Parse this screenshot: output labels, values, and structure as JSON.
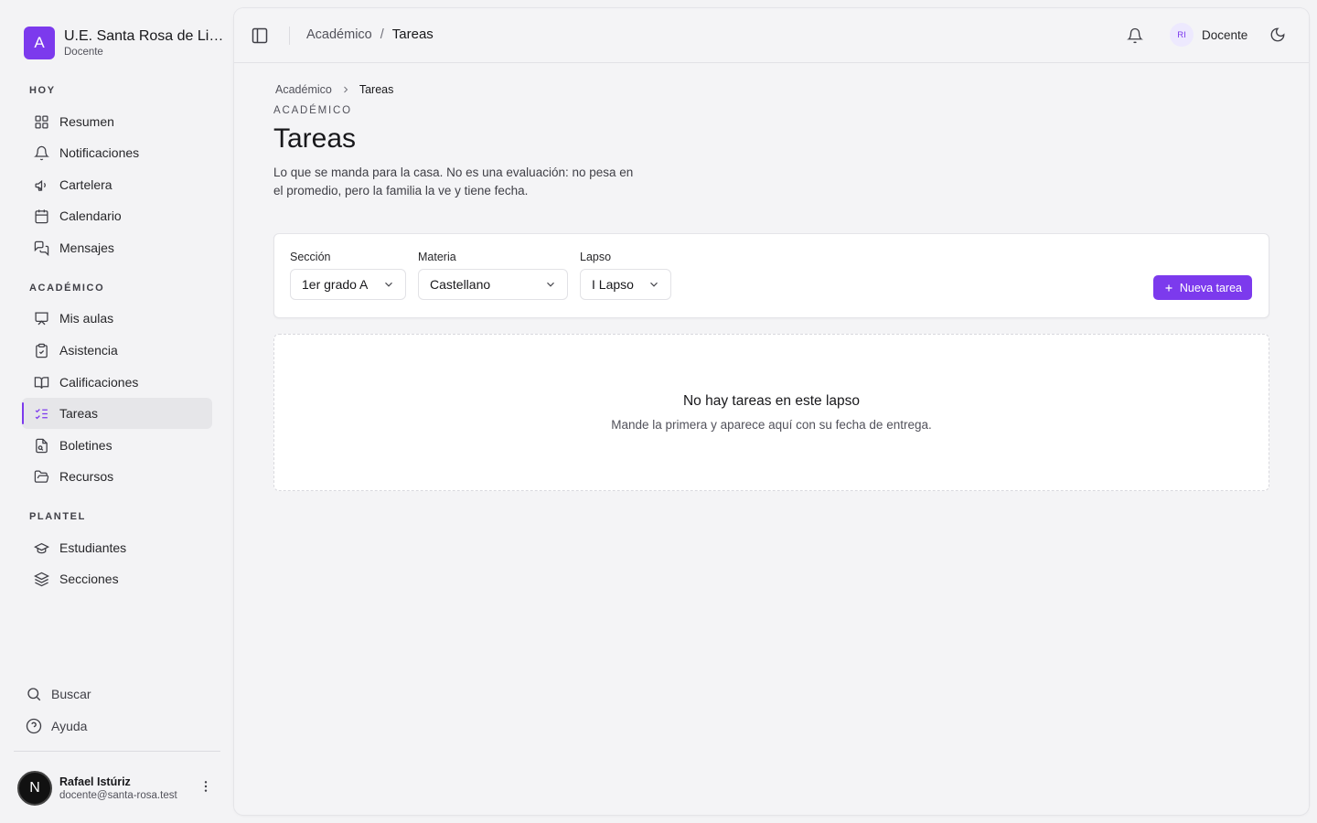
{
  "brand": {
    "logo_letter": "A",
    "name": "U.E. Santa Rosa de Li…",
    "role": "Docente"
  },
  "nav": {
    "groups": [
      {
        "label": "HOY",
        "items": [
          {
            "label": "Resumen",
            "icon": "grid-icon"
          },
          {
            "label": "Notificaciones",
            "icon": "bell-icon"
          },
          {
            "label": "Cartelera",
            "icon": "megaphone-icon"
          },
          {
            "label": "Calendario",
            "icon": "calendar-icon"
          },
          {
            "label": "Mensajes",
            "icon": "messages-icon"
          }
        ]
      },
      {
        "label": "ACADÉMICO",
        "items": [
          {
            "label": "Mis aulas",
            "icon": "presentation-icon"
          },
          {
            "label": "Asistencia",
            "icon": "clipboard-check-icon"
          },
          {
            "label": "Calificaciones",
            "icon": "book-open-icon"
          },
          {
            "label": "Tareas",
            "icon": "list-checks-icon",
            "active": true
          },
          {
            "label": "Boletines",
            "icon": "file-report-icon"
          },
          {
            "label": "Recursos",
            "icon": "folder-open-icon"
          }
        ]
      },
      {
        "label": "PLANTEL",
        "items": [
          {
            "label": "Estudiantes",
            "icon": "graduation-cap-icon"
          },
          {
            "label": "Secciones",
            "icon": "layers-icon"
          }
        ]
      }
    ],
    "bottom": [
      {
        "label": "Buscar",
        "icon": "search-icon"
      },
      {
        "label": "Ayuda",
        "icon": "help-circle-icon"
      }
    ]
  },
  "user": {
    "initial": "N",
    "name": "Rafael Istúriz",
    "email": "docente@santa-rosa.test"
  },
  "topbar": {
    "breadcrumb_parent": "Académico",
    "breadcrumb_sep": "/",
    "breadcrumb_current": "Tareas",
    "role_initials": "RI",
    "role_label": "Docente"
  },
  "page": {
    "breadcrumb_parent": "Académico",
    "breadcrumb_current": "Tareas",
    "eyebrow": "ACADÉMICO",
    "title": "Tareas",
    "description": "Lo que se manda para la casa. No es una evaluación: no pesa en el promedio, pero la familia la ve y tiene fecha."
  },
  "filters": {
    "seccion": {
      "label": "Sección",
      "value": "1er grado A"
    },
    "materia": {
      "label": "Materia",
      "value": "Castellano"
    },
    "lapso": {
      "label": "Lapso",
      "value": "I Lapso"
    },
    "new_button": "Nueva tarea"
  },
  "empty": {
    "title": "No hay tareas en este lapso",
    "subtitle": "Mande la primera y aparece aquí con su fecha de entrega."
  },
  "colors": {
    "accent": "#7c3aed",
    "background": "#f3f3f5",
    "card": "#ffffff"
  }
}
